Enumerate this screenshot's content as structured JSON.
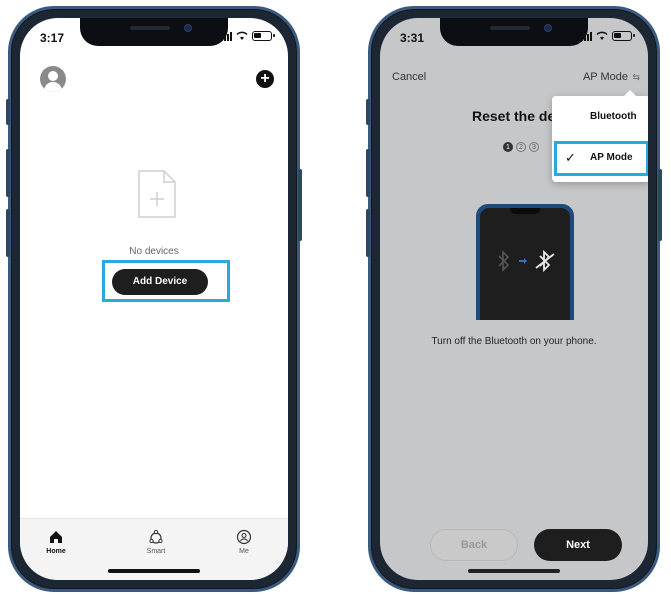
{
  "left_phone": {
    "status_time": "3:17",
    "empty_text": "No devices",
    "add_button_label": "Add Device",
    "tabs": [
      {
        "label": "Home",
        "icon": "home-icon"
      },
      {
        "label": "Smart",
        "icon": "smart-icon"
      },
      {
        "label": "Me",
        "icon": "profile-icon"
      }
    ]
  },
  "right_phone": {
    "status_time": "3:31",
    "cancel_label": "Cancel",
    "mode_label": "AP Mode",
    "title": "Reset the de",
    "steps": [
      "1",
      "2",
      "3"
    ],
    "dropdown_options": [
      {
        "label": "Bluetooth",
        "selected": false
      },
      {
        "label": "AP Mode",
        "selected": true
      }
    ],
    "instruction": "Turn off the Bluetooth on your phone.",
    "back_label": "Back",
    "next_label": "Next"
  },
  "colors": {
    "highlight": "#2aa8e0",
    "button_dark": "#1e1e1e",
    "phone_frame": "#3a5a80",
    "screen_grey": "#c6c7c8"
  }
}
